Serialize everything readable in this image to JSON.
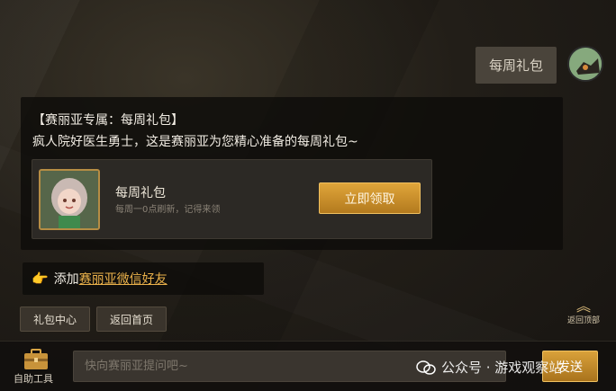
{
  "conversation": {
    "user_message": "每周礼包",
    "bot_title": "【赛丽亚专属：每周礼包】",
    "bot_text": "疯人院好医生勇士，这是赛丽亚为您精心准备的每周礼包~",
    "gift": {
      "name": "每周礼包",
      "subtitle": "每周一0点刷新，记得来领",
      "claim_label": "立即领取"
    },
    "wechat": {
      "prefix": "添加",
      "link": "赛丽亚微信好友"
    }
  },
  "quick_buttons": [
    "礼包中心",
    "返回首页"
  ],
  "back_to_top_label": "返回顶部",
  "bottom_bar": {
    "tool_label": "自助工具",
    "input_placeholder": "快向赛丽亚提问吧~",
    "send_label": "发送"
  },
  "watermark": "公众号 · 游戏观察站",
  "colors": {
    "accent": "#e0a53a",
    "link": "#e9b04a",
    "panel": "#0e0c0a"
  }
}
